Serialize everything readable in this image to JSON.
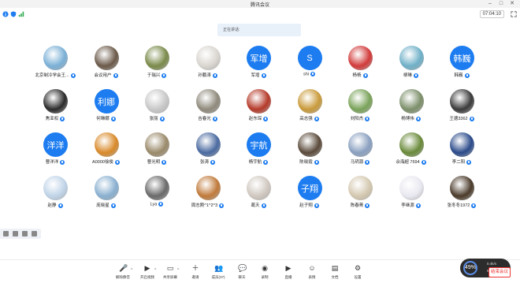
{
  "window": {
    "title": "腾讯会议"
  },
  "topbar": {
    "timer": "07:04:10"
  },
  "tip": {
    "text": "正在讲话:"
  },
  "participants": [
    {
      "name": "北京制冷学会王...",
      "kind": "photo",
      "color": "#7ab0d6"
    },
    {
      "name": "会议用户",
      "kind": "photo",
      "color": "#6b5a4a"
    },
    {
      "name": "于瑞兴",
      "kind": "photo",
      "color": "#7a8a4a"
    },
    {
      "name": "孙鹏涛",
      "kind": "photo",
      "color": "#d9d5cf"
    },
    {
      "name": "军增",
      "kind": "text",
      "avatar_text": "军增"
    },
    {
      "name": "shi",
      "kind": "text",
      "avatar_text": "S"
    },
    {
      "name": "杨杨",
      "kind": "photo",
      "color": "#d23a3a"
    },
    {
      "name": "柳琳",
      "kind": "photo",
      "color": "#6fb0c8"
    },
    {
      "name": "韩巍",
      "kind": "text",
      "avatar_text": "韩巍"
    },
    {
      "name": "焦亚权",
      "kind": "photo",
      "color": "#2b2b2b"
    },
    {
      "name": "何琳娜",
      "kind": "text",
      "avatar_text": "利娜"
    },
    {
      "name": "张丽",
      "kind": "photo",
      "color": "#c8c8c8"
    },
    {
      "name": "吉春光",
      "kind": "photo",
      "color": "#8f8a7c"
    },
    {
      "name": "赵东琛",
      "kind": "photo",
      "color": "#b53a2a"
    },
    {
      "name": "高志强",
      "kind": "photo",
      "color": "#c99a3a"
    },
    {
      "name": "刘阳杰",
      "kind": "photo",
      "color": "#7aa35a"
    },
    {
      "name": "杨博伟",
      "kind": "photo",
      "color": "#7c8f6a"
    },
    {
      "name": "王德3362",
      "kind": "photo",
      "color": "#3a3a3a"
    },
    {
      "name": "曹洋洋",
      "kind": "text",
      "avatar_text": "洋洋"
    },
    {
      "name": "A0000徐俊",
      "kind": "photo",
      "color": "#d98a2a"
    },
    {
      "name": "曹光明",
      "kind": "photo",
      "color": "#9a8a6a"
    },
    {
      "name": "张涛",
      "kind": "photo",
      "color": "#4a6aa0"
    },
    {
      "name": "杨宇航",
      "kind": "text",
      "avatar_text": "宇航"
    },
    {
      "name": "陈晓霞",
      "kind": "photo",
      "color": "#5a4a3a"
    },
    {
      "name": "马玥源",
      "kind": "photo",
      "color": "#8aa0c0"
    },
    {
      "name": "佘海超 7694",
      "kind": "photo",
      "color": "#6a8a3a"
    },
    {
      "name": "李二阳",
      "kind": "photo",
      "color": "#2a4a8a"
    },
    {
      "name": "赵静",
      "kind": "photo",
      "color": "#c0d4e8"
    },
    {
      "name": "庞晓星",
      "kind": "photo",
      "color": "#8ab0d0"
    },
    {
      "name": "Lya",
      "kind": "photo",
      "color": "#6a6a6a"
    },
    {
      "name": "周志刚^1^2^3",
      "kind": "photo",
      "color": "#c07a3a"
    },
    {
      "name": "葛天",
      "kind": "photo",
      "color": "#d0c8c0"
    },
    {
      "name": "赵子翔",
      "kind": "text",
      "avatar_text": "子翔"
    },
    {
      "name": "陈春菁",
      "kind": "photo",
      "color": "#d4c8b0"
    },
    {
      "name": "李继源",
      "kind": "photo",
      "color": "#e8e8f0"
    },
    {
      "name": "张冬冬1972",
      "kind": "photo",
      "color": "#4a3a2a"
    }
  ],
  "toolbar": [
    {
      "label": "解除静音",
      "icon": "mic-icon",
      "glyph": "🎤"
    },
    {
      "label": "开启视频",
      "icon": "camera-icon",
      "glyph": "▶"
    },
    {
      "label": "共享屏幕",
      "icon": "share-screen-icon",
      "glyph": "▭"
    },
    {
      "label": "邀请",
      "icon": "invite-icon",
      "glyph": "＋"
    },
    {
      "label": "成员(37)",
      "icon": "members-icon",
      "glyph": "👥"
    },
    {
      "label": "聊天",
      "icon": "chat-icon",
      "glyph": "💬"
    },
    {
      "label": "录制",
      "icon": "record-icon",
      "glyph": "◉"
    },
    {
      "label": "直播",
      "icon": "live-icon",
      "glyph": "▶"
    },
    {
      "label": "表情",
      "icon": "emoji-icon",
      "glyph": "☺"
    },
    {
      "label": "文档",
      "icon": "doc-icon",
      "glyph": "▤"
    },
    {
      "label": "设置",
      "icon": "settings-icon",
      "glyph": "⚙"
    }
  ],
  "network": {
    "cpu": "49%",
    "up": "0.4k/s",
    "down": "5.1k/s"
  },
  "end_button": "结束会议"
}
